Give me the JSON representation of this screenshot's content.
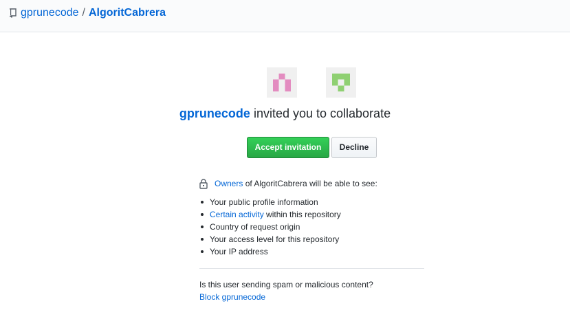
{
  "breadcrumb": {
    "owner": "gprunecode",
    "separator": "/",
    "repo": "AlgoritCabrera"
  },
  "invitation": {
    "inviter": "gprunecode",
    "headline_rest": "invited you to collaborate",
    "accept_label": "Accept invitation",
    "decline_label": "Decline"
  },
  "visibility": {
    "owners_link": "Owners",
    "owners_rest": "of AlgoritCabrera will be able to see:",
    "items": [
      {
        "link": "",
        "text": "Your public profile information"
      },
      {
        "link": "Certain activity",
        "text": "within this repository"
      },
      {
        "link": "",
        "text": "Country of request origin"
      },
      {
        "link": "",
        "text": "Your access level for this repository"
      },
      {
        "link": "",
        "text": "Your IP address"
      }
    ]
  },
  "spam": {
    "question": "Is this user sending spam or malicious content?",
    "block_label": "Block gprunecode"
  },
  "colors": {
    "link": "#0366d6",
    "accept_green": "#28a745",
    "avatar_pink": "#e38cc0",
    "avatar_green": "#8fd072"
  },
  "icons": {
    "repo": "repo-icon",
    "lock": "lock-icon"
  }
}
